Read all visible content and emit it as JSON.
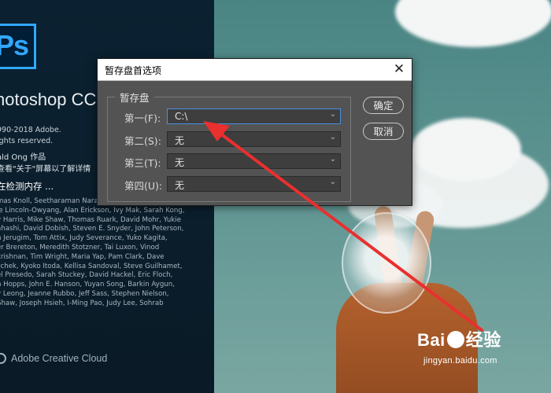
{
  "splash": {
    "logo": "Ps",
    "product": "hotoshop CC",
    "copyright": [
      "990-2018 Adobe.",
      "ights reserved."
    ],
    "artwork": [
      "ald Ong 作品",
      "查看\"关于\"屏幕以了解详情"
    ],
    "status": "在检测内存 ...",
    "credits": [
      "mas Knoll, Seetharaman Naray",
      "ie Lincoln-Owyang, Alan Erickson, Ivy Mak, Sarah Kong,",
      "y Harris, Mike Shaw, Thomas Ruark, David Mohr, Yukie",
      "ahashi, David Dobish, Steven E. Snyder, John Peterson,",
      "n Jerugim, Tom Attix, Judy Severance, Yuko Kagita,",
      "er Brereton, Meredith Stotzner, Tai Luxon, Vinod",
      "krishnan, Tim Wright, Maria Yap, Pam Clark, Dave",
      "schek, Kyoko Itoda, Kellisa Sandoval, Steve Guilhamet,",
      "el Presedo, Sarah Stuckey, David Hackel, Eric Floch,",
      "n Hopps, John E. Hanson, Yuyan Song, Barkin Aygun,",
      "y Leong, Jeanne Rubbo, Jeff Sass, Stephen Nielson,",
      "Shaw, Joseph Hsieh, I-Ming Pao, Judy Lee, Sohrab"
    ],
    "creative_cloud": "Adobe Creative Cloud"
  },
  "dialog": {
    "title": "暂存盘首选项",
    "close": "✕",
    "group_label": "暂存盘",
    "rows": [
      {
        "label": "第一(F):",
        "value": "C:\\"
      },
      {
        "label": "第二(S):",
        "value": "无"
      },
      {
        "label": "第三(T):",
        "value": "无"
      },
      {
        "label": "第四(U):",
        "value": "无"
      }
    ],
    "ok_label": "确定",
    "cancel_label": "取消"
  },
  "watermark": {
    "brand_left": "Bai",
    "brand_right": "经验",
    "url": "jingyan.baidu.com"
  },
  "colors": {
    "dialog_bg": "#535353",
    "focus_border": "#4a90e2",
    "ps_blue": "#31a8ff",
    "arrow_red": "#e8302f"
  }
}
